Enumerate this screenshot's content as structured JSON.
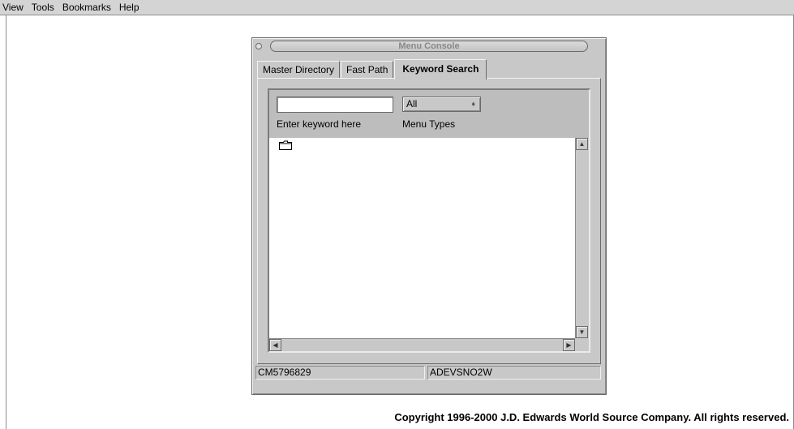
{
  "menubar": {
    "items": [
      "View",
      "Tools",
      "Bookmarks",
      "Help"
    ]
  },
  "window": {
    "title": "Menu Console",
    "tabs": [
      {
        "label": "Master Directory",
        "active": false
      },
      {
        "label": "Fast Path",
        "active": false
      },
      {
        "label": "Keyword Search",
        "active": true
      }
    ],
    "keyword_input": {
      "value": "",
      "label": "Enter keyword here"
    },
    "menu_types": {
      "selected": "All",
      "label": "Menu Types"
    },
    "status": {
      "left": "CM5796829",
      "right": "ADEVSNO2W"
    }
  },
  "footer": {
    "copyright": "Copyright 1996-2000 J.D. Edwards World Source Company. All rights reserved."
  },
  "icons": {
    "folder": "folder-icon",
    "scroll_up": "scroll-up-arrow-icon",
    "scroll_down": "scroll-down-arrow-icon",
    "scroll_left": "scroll-left-arrow-icon",
    "scroll_right": "scroll-right-arrow-icon",
    "select": "dropdown-arrow-icon"
  },
  "colors": {
    "window_bg": "#c8c8c8",
    "menubar_bg": "#d4d4d4"
  }
}
